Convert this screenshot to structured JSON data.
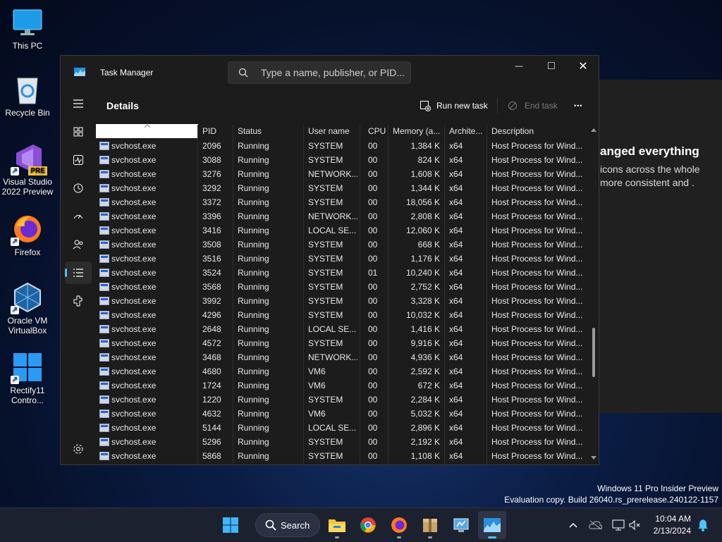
{
  "desktop": {
    "icons": [
      {
        "label": "This PC",
        "icon": "monitor-icon"
      },
      {
        "label": "Recycle Bin",
        "icon": "recycle-bin-icon"
      },
      {
        "label": "Visual Studio 2022 Preview",
        "icon": "visual-studio-icon",
        "badge": "PRE"
      },
      {
        "label": "Firefox",
        "icon": "firefox-icon"
      },
      {
        "label": "Oracle VM VirtualBox",
        "icon": "virtualbox-icon"
      },
      {
        "label": "Rectify11 Contro...",
        "icon": "rectify11-icon"
      }
    ],
    "shortcut_arrow": "↗"
  },
  "background_window": {
    "heading": "anged everything",
    "text": "icons across the whole more consistent and ."
  },
  "window": {
    "title": "Task Manager",
    "search_placeholder": "Type a name, publisher, or PID...",
    "minimize": "—",
    "maximize": "□",
    "close": "✕"
  },
  "header": {
    "title": "Details",
    "run_new_task": "Run new task",
    "end_task": "End task",
    "more": "•••"
  },
  "nav": [
    {
      "name": "nav-menu",
      "icon": "hamburger-icon"
    },
    {
      "name": "nav-processes",
      "icon": "processes-icon"
    },
    {
      "name": "nav-performance",
      "icon": "performance-icon"
    },
    {
      "name": "nav-app-history",
      "icon": "history-icon"
    },
    {
      "name": "nav-startup-apps",
      "icon": "startup-icon"
    },
    {
      "name": "nav-users",
      "icon": "users-icon"
    },
    {
      "name": "nav-details",
      "icon": "details-icon",
      "active": true
    },
    {
      "name": "nav-services",
      "icon": "services-icon"
    },
    {
      "name": "nav-settings",
      "icon": "settings-icon"
    }
  ],
  "table": {
    "columns": [
      "",
      "PID",
      "Status",
      "User name",
      "CPU",
      "Memory (a...",
      "Archite...",
      "Description"
    ],
    "rows": [
      [
        "svchost.exe",
        "2096",
        "Running",
        "SYSTEM",
        "00",
        "1,384 K",
        "x64",
        "Host Process for Wind..."
      ],
      [
        "svchost.exe",
        "3088",
        "Running",
        "SYSTEM",
        "00",
        "824 K",
        "x64",
        "Host Process for Wind..."
      ],
      [
        "svchost.exe",
        "3276",
        "Running",
        "NETWORK...",
        "00",
        "1,608 K",
        "x64",
        "Host Process for Wind..."
      ],
      [
        "svchost.exe",
        "3292",
        "Running",
        "SYSTEM",
        "00",
        "1,344 K",
        "x64",
        "Host Process for Wind..."
      ],
      [
        "svchost.exe",
        "3372",
        "Running",
        "SYSTEM",
        "00",
        "18,056 K",
        "x64",
        "Host Process for Wind..."
      ],
      [
        "svchost.exe",
        "3396",
        "Running",
        "NETWORK...",
        "00",
        "2,808 K",
        "x64",
        "Host Process for Wind..."
      ],
      [
        "svchost.exe",
        "3416",
        "Running",
        "LOCAL SE...",
        "00",
        "12,060 K",
        "x64",
        "Host Process for Wind..."
      ],
      [
        "svchost.exe",
        "3508",
        "Running",
        "SYSTEM",
        "00",
        "668 K",
        "x64",
        "Host Process for Wind..."
      ],
      [
        "svchost.exe",
        "3516",
        "Running",
        "SYSTEM",
        "00",
        "1,176 K",
        "x64",
        "Host Process for Wind..."
      ],
      [
        "svchost.exe",
        "3524",
        "Running",
        "SYSTEM",
        "01",
        "10,240 K",
        "x64",
        "Host Process for Wind..."
      ],
      [
        "svchost.exe",
        "3568",
        "Running",
        "SYSTEM",
        "00",
        "2,752 K",
        "x64",
        "Host Process for Wind..."
      ],
      [
        "svchost.exe",
        "3992",
        "Running",
        "SYSTEM",
        "00",
        "3,328 K",
        "x64",
        "Host Process for Wind..."
      ],
      [
        "svchost.exe",
        "4296",
        "Running",
        "SYSTEM",
        "00",
        "10,032 K",
        "x64",
        "Host Process for Wind..."
      ],
      [
        "svchost.exe",
        "2648",
        "Running",
        "LOCAL SE...",
        "00",
        "1,416 K",
        "x64",
        "Host Process for Wind..."
      ],
      [
        "svchost.exe",
        "4572",
        "Running",
        "SYSTEM",
        "00",
        "9,916 K",
        "x64",
        "Host Process for Wind..."
      ],
      [
        "svchost.exe",
        "3468",
        "Running",
        "NETWORK...",
        "00",
        "4,936 K",
        "x64",
        "Host Process for Wind..."
      ],
      [
        "svchost.exe",
        "4680",
        "Running",
        "VM6",
        "00",
        "2,592 K",
        "x64",
        "Host Process for Wind..."
      ],
      [
        "svchost.exe",
        "1724",
        "Running",
        "VM6",
        "00",
        "672 K",
        "x64",
        "Host Process for Wind..."
      ],
      [
        "svchost.exe",
        "1220",
        "Running",
        "SYSTEM",
        "00",
        "2,284 K",
        "x64",
        "Host Process for Wind..."
      ],
      [
        "svchost.exe",
        "4632",
        "Running",
        "VM6",
        "00",
        "5,032 K",
        "x64",
        "Host Process for Wind..."
      ],
      [
        "svchost.exe",
        "5144",
        "Running",
        "LOCAL SE...",
        "00",
        "2,896 K",
        "x64",
        "Host Process for Wind..."
      ],
      [
        "svchost.exe",
        "5296",
        "Running",
        "SYSTEM",
        "00",
        "2,192 K",
        "x64",
        "Host Process for Wind..."
      ],
      [
        "svchost.exe",
        "5868",
        "Running",
        "SYSTEM",
        "00",
        "1,108 K",
        "x64",
        "Host Process for Wind..."
      ]
    ],
    "scroll_position": 0.72
  },
  "watermark": {
    "line1": "Windows 11 Pro Insider Preview",
    "line2": "Evaluation copy. Build 26040.rs_prerelease.240122-1157"
  },
  "taskbar": {
    "search_label": "Search",
    "apps": [
      "start-icon",
      "file-explorer-icon",
      "chrome-icon",
      "firefox-icon",
      "package-icon",
      "control-panel-icon",
      "task-manager-icon"
    ],
    "time": "10:04 AM",
    "date": "2/13/2024"
  },
  "colors": {
    "accent": "#4cc2ff",
    "window_bg": "#1c1c1c"
  }
}
